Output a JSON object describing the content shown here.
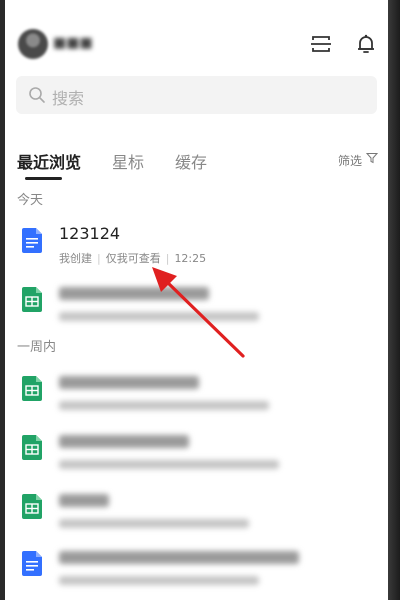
{
  "search": {
    "placeholder": "搜索"
  },
  "tabs": [
    {
      "label": "最近浏览",
      "active": true
    },
    {
      "label": "星标",
      "active": false
    },
    {
      "label": "缓存",
      "active": false
    }
  ],
  "filter_label": "筛选",
  "sections": {
    "today": "今天",
    "week": "一周内"
  },
  "recent_today": [
    {
      "title": "123124",
      "creator": "我创建",
      "permission": "仅我可查看",
      "time": "12:25",
      "icon": "doc-icon",
      "color": "#3370ff"
    }
  ],
  "colors": {
    "doc_blue": "#3370ff",
    "sheet_green": "#21a366",
    "annotation_red": "#e02020"
  }
}
